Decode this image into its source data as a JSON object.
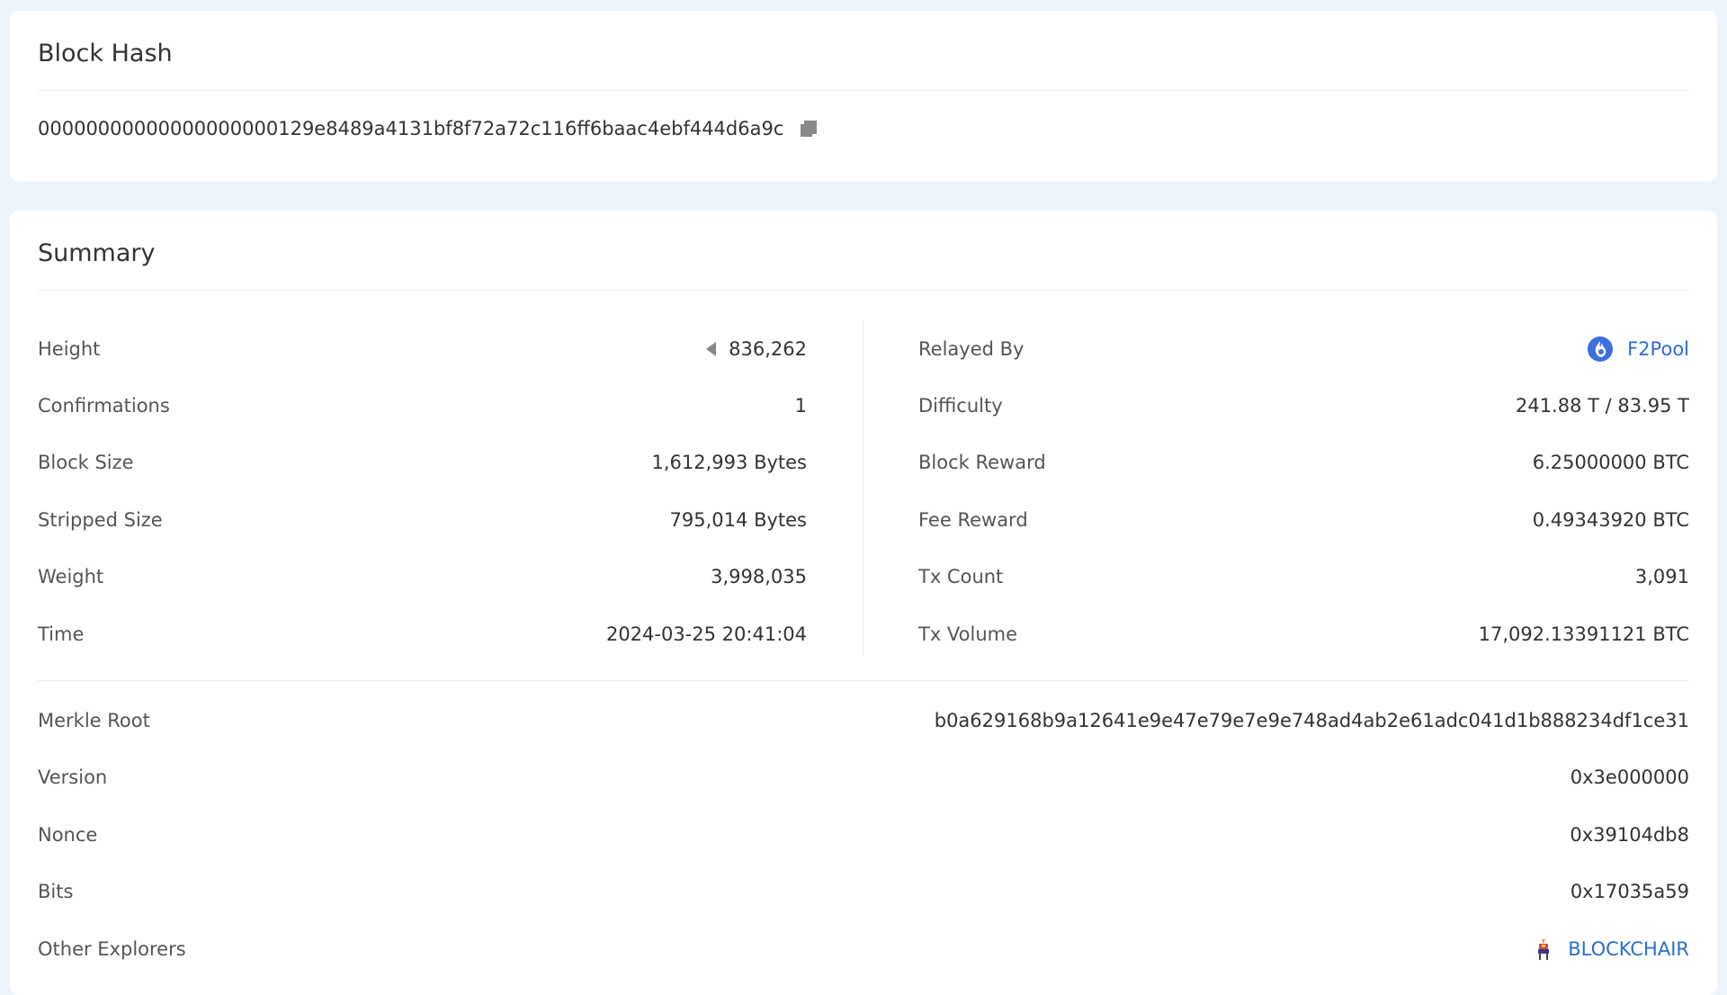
{
  "hash_card": {
    "title": "Block Hash",
    "hash": "00000000000000000000129e8489a4131bf8f72a72c116ff6baac4ebf444d6a9c",
    "copy_icon": "copy-icon"
  },
  "summary": {
    "title": "Summary",
    "left": [
      {
        "label": "Height",
        "value": "836,262"
      },
      {
        "label": "Confirmations",
        "value": "1"
      },
      {
        "label": "Block Size",
        "value": "1,612,993 Bytes"
      },
      {
        "label": "Stripped Size",
        "value": "795,014 Bytes"
      },
      {
        "label": "Weight",
        "value": "3,998,035"
      },
      {
        "label": "Time",
        "value": "2024-03-25 20:41:04"
      }
    ],
    "right": [
      {
        "label": "Relayed By",
        "value": "F2Pool"
      },
      {
        "label": "Difficulty",
        "value": "241.88 T / 83.95 T"
      },
      {
        "label": "Block Reward",
        "value": "6.25000000 BTC"
      },
      {
        "label": "Fee Reward",
        "value": "0.49343920 BTC"
      },
      {
        "label": "Tx Count",
        "value": "3,091"
      },
      {
        "label": "Tx Volume",
        "value": "17,092.13391121 BTC"
      }
    ],
    "lower": [
      {
        "label": "Merkle Root",
        "value": "b0a629168b9a12641e9e47e79e7e9e748ad4ab2e61adc041d1b888234df1ce31"
      },
      {
        "label": "Version",
        "value": "0x3e000000"
      },
      {
        "label": "Nonce",
        "value": "0x39104db8"
      },
      {
        "label": "Bits",
        "value": "0x17035a59"
      },
      {
        "label": "Other Explorers",
        "value": "BLOCKCHAIR"
      }
    ]
  },
  "icons": {
    "prev_block": "arrow-left-icon",
    "pool": "f2pool-icon",
    "explorer": "blockchair-icon"
  },
  "colors": {
    "background": "#eef4fb",
    "card": "#ffffff",
    "link": "#2c6fd1",
    "pool_icon": "#3d6fe0"
  }
}
